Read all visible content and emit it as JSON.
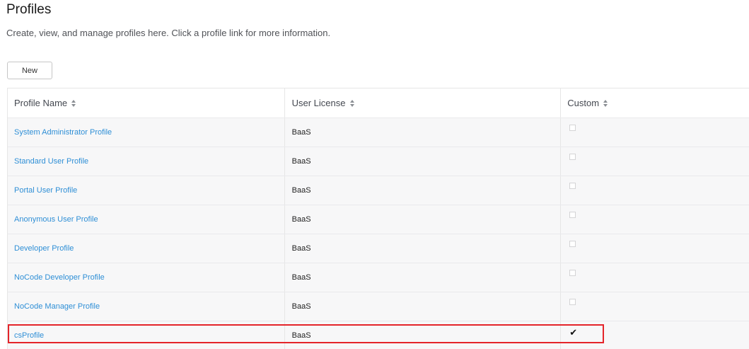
{
  "page": {
    "title": "Profiles",
    "description": "Create, view, and manage profiles here. Click a profile link for more information.",
    "new_button": "New"
  },
  "table": {
    "columns": [
      {
        "label": "Profile Name",
        "sort_icon": "sort-icon"
      },
      {
        "label": "User License",
        "sort_icon": "sort-icon"
      },
      {
        "label": "Custom",
        "sort_icon": "sort-icon"
      }
    ],
    "rows": [
      {
        "name": "System Administrator Profile",
        "license": "BaaS",
        "custom": false
      },
      {
        "name": "Standard User Profile",
        "license": "BaaS",
        "custom": false
      },
      {
        "name": "Portal User Profile",
        "license": "BaaS",
        "custom": false
      },
      {
        "name": "Anonymous User Profile",
        "license": "BaaS",
        "custom": false
      },
      {
        "name": "Developer Profile",
        "license": "BaaS",
        "custom": false
      },
      {
        "name": "NoCode Developer Profile",
        "license": "BaaS",
        "custom": false
      },
      {
        "name": "NoCode Manager Profile",
        "license": "BaaS",
        "custom": false
      },
      {
        "name": "csProfile",
        "license": "BaaS",
        "custom": true
      }
    ]
  },
  "colors": {
    "link": "#2f8fd6",
    "highlight": "#e4242a",
    "row_background": "#f7f7f8"
  }
}
